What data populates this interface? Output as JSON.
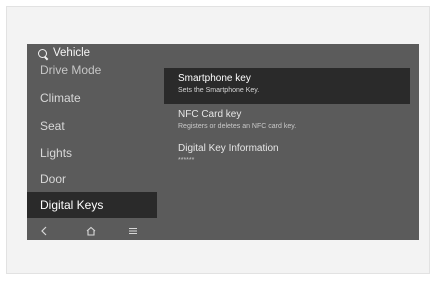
{
  "header": {
    "search_icon": "search-icon",
    "title": "Vehicle"
  },
  "sidebar": {
    "items": [
      {
        "label": "Drive Mode",
        "state": "partially-scrolled"
      },
      {
        "label": "Climate"
      },
      {
        "label": "Seat"
      },
      {
        "label": "Lights"
      },
      {
        "label": "Door"
      },
      {
        "label": "Digital Keys",
        "state": "selected"
      }
    ]
  },
  "main": {
    "items": [
      {
        "title": "Smartphone key",
        "subtitle": "Sets the Smartphone Key.",
        "state": "selected"
      },
      {
        "title": "NFC Card key",
        "subtitle": "Registers or deletes an NFC card key."
      },
      {
        "title": "Digital Key Information",
        "subtitle": "******"
      }
    ]
  },
  "bottom_nav": {
    "icons": [
      "back-icon",
      "home-icon",
      "menu-icon"
    ]
  },
  "colors": {
    "screen_bg": "#5b5b5b",
    "selected_bg": "#2a2a2a",
    "text_primary": "#f4f4f4"
  }
}
